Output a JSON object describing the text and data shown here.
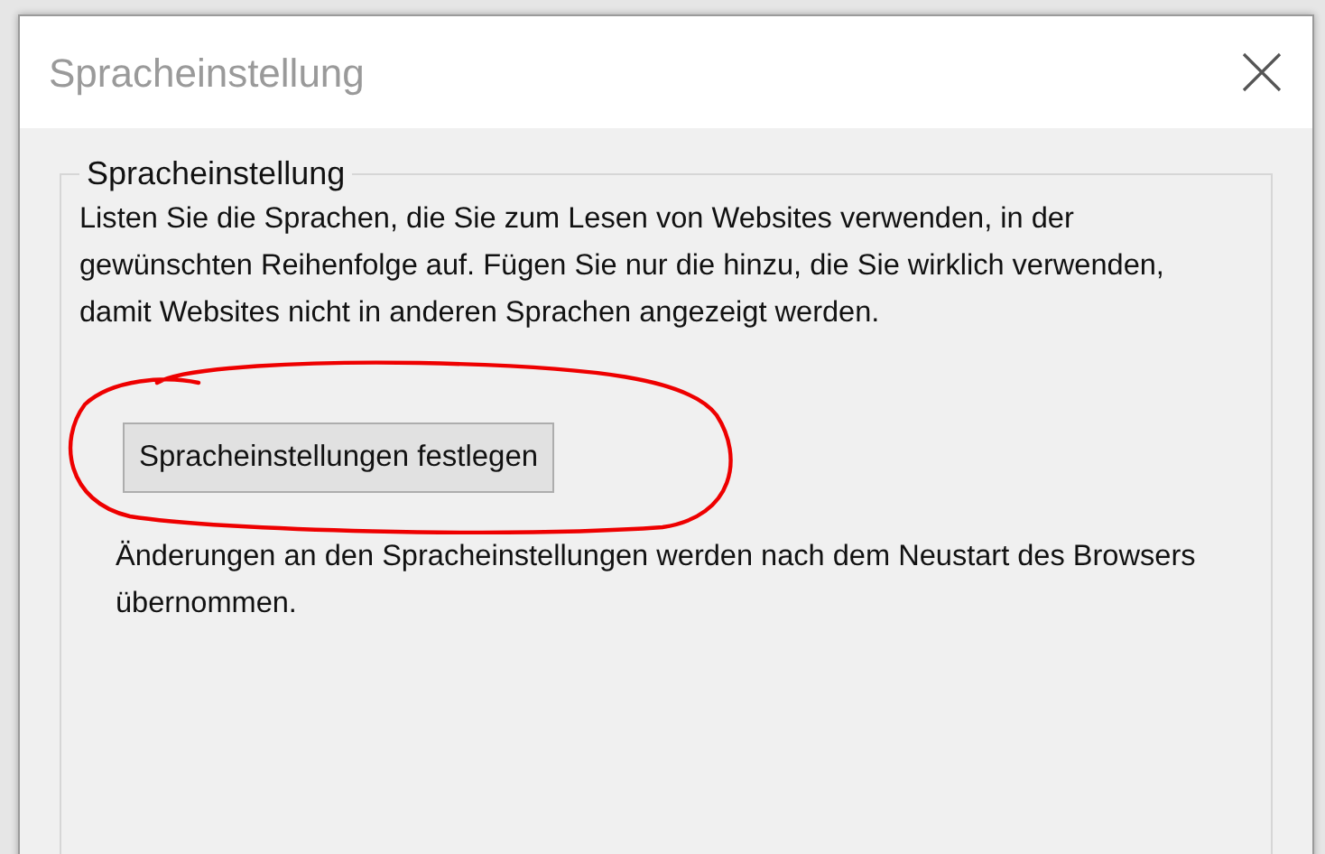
{
  "window": {
    "title": "Spracheinstellung"
  },
  "group": {
    "legend": "Spracheinstellung",
    "description": "Listen Sie die Sprachen, die Sie zum Lesen von Websites verwenden, in der gewünschten Reihenfolge auf. Fügen Sie nur die hinzu, die Sie wirklich verwenden, damit Websites nicht in anderen Sprachen angezeigt werden.",
    "button": "Spracheinstellungen festlegen",
    "note": "Änderungen an den Spracheinstellungen werden nach dem Neustart des Browsers übernommen."
  }
}
